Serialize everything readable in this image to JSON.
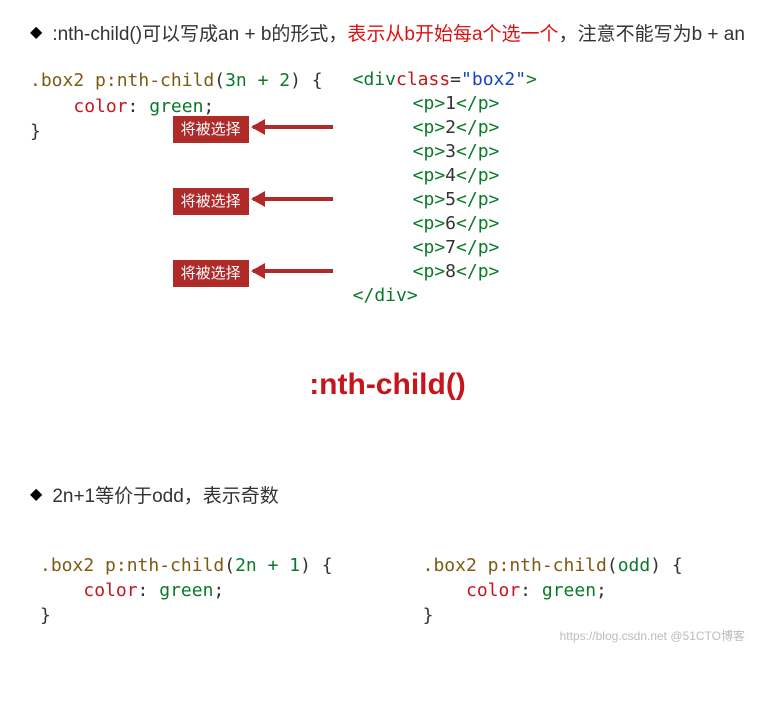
{
  "section1": {
    "bullet_pre": ":nth-child()可以写成an + b的形式，",
    "bullet_red": "表示从b开始每a个选一个",
    "bullet_post": "，注意不能写为b + an",
    "css": {
      "selector": ".box2 p:nth-child",
      "arg": "3n + 2",
      "prop": "color",
      "val": "green"
    },
    "html_open_tag": "div",
    "html_attr": "class",
    "html_attr_val": "box2",
    "items": [
      {
        "n": "1",
        "selected": false
      },
      {
        "n": "2",
        "selected": true
      },
      {
        "n": "3",
        "selected": false
      },
      {
        "n": "4",
        "selected": false
      },
      {
        "n": "5",
        "selected": true
      },
      {
        "n": "6",
        "selected": false
      },
      {
        "n": "7",
        "selected": false
      },
      {
        "n": "8",
        "selected": true
      }
    ],
    "badge_label": "将被选择",
    "p_tag": "p",
    "close_tag": "div"
  },
  "heading": ":nth-child()",
  "section2": {
    "bullet": "2n+1等价于odd，表示奇数"
  },
  "section3": {
    "left": {
      "selector": ".box2 p:nth-child",
      "arg": "2n + 1",
      "prop": "color",
      "val": "green"
    },
    "right": {
      "selector": ".box2 p:nth-child",
      "arg": "odd",
      "prop": "color",
      "val": "green"
    }
  },
  "watermark": "https://blog.csdn.net @51CTO博客"
}
